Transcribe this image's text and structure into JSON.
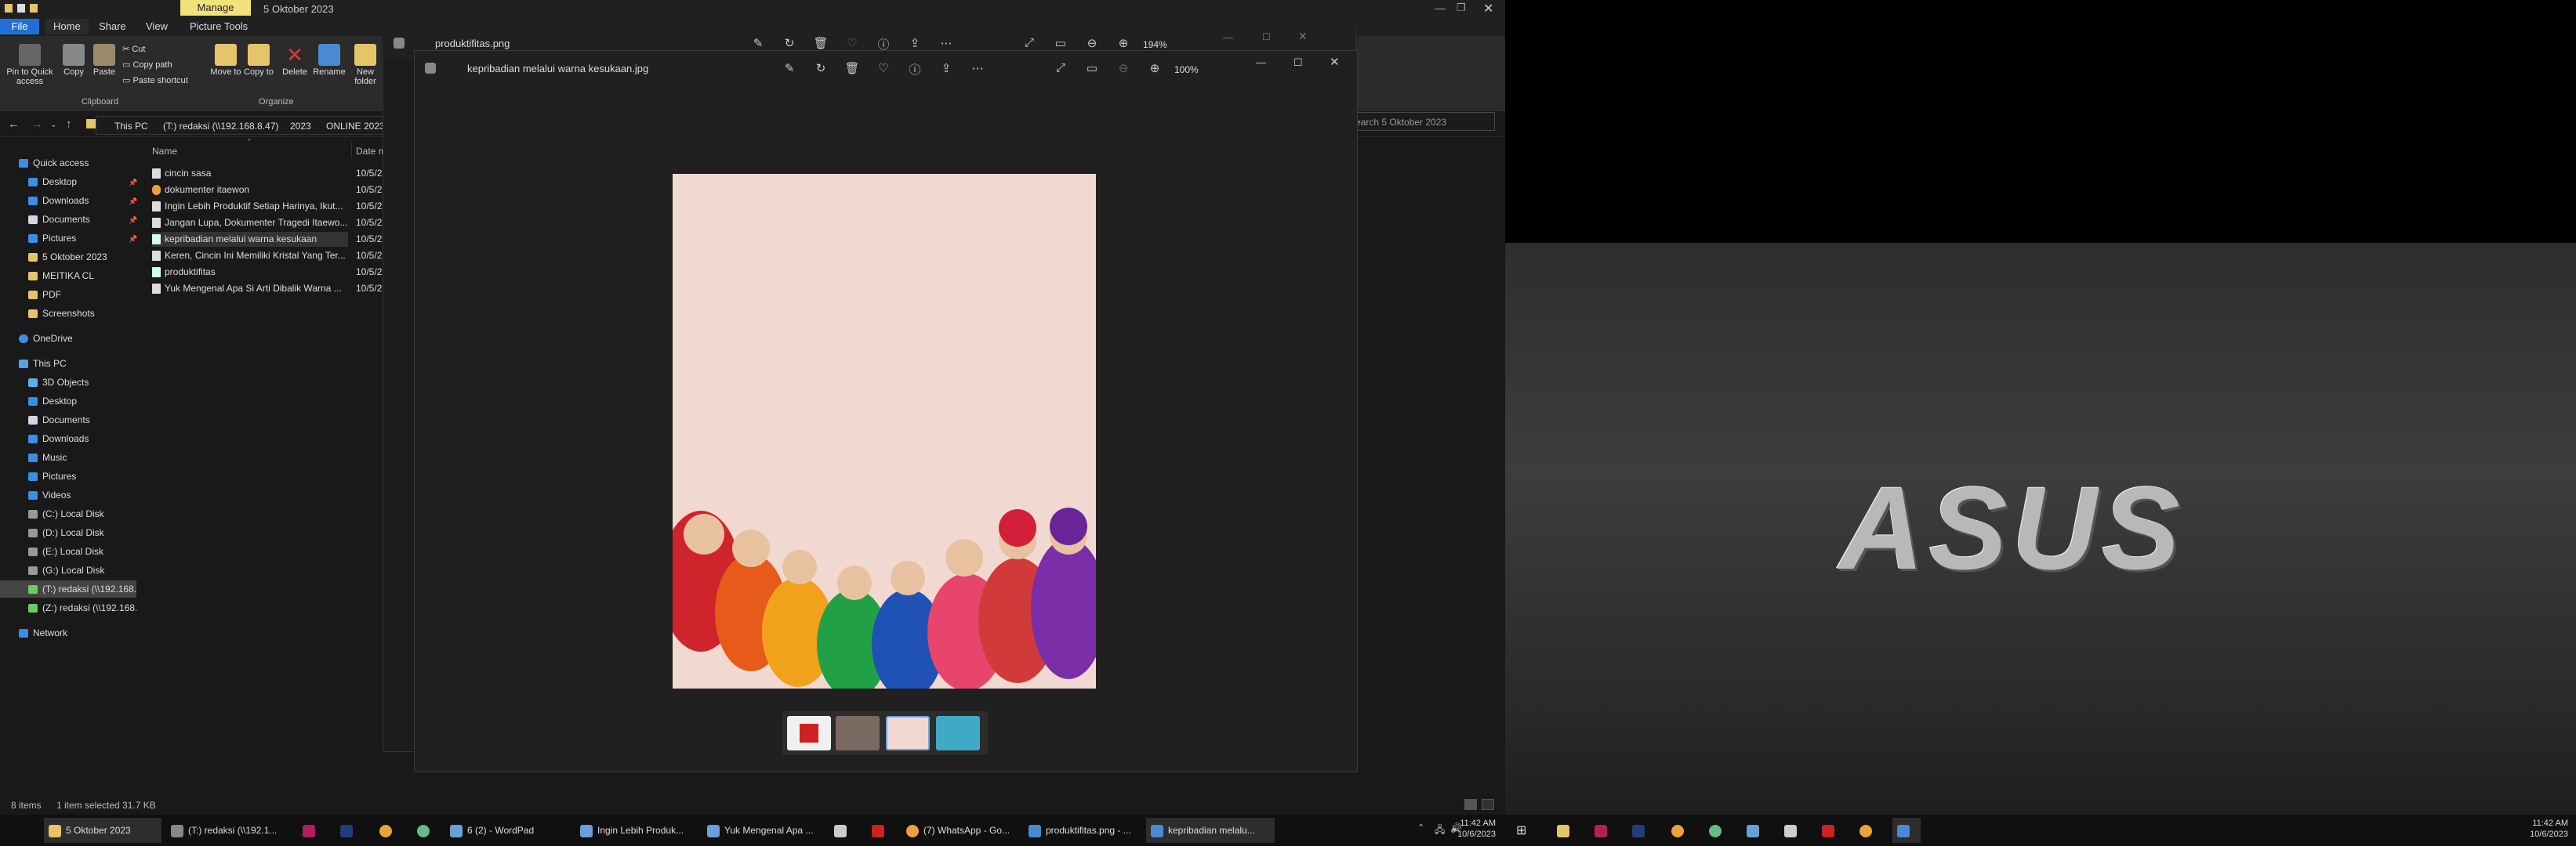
{
  "explorer": {
    "title": "5 Oktober 2023",
    "manage_tab": "Manage",
    "tabs": [
      "File",
      "Home",
      "Share",
      "View",
      "Picture Tools"
    ],
    "ribbon": {
      "pin": "Pin to Quick access",
      "copy": "Copy",
      "paste": "Paste",
      "cut": "Cut",
      "copy_path": "Copy path",
      "paste_shortcut": "Paste shortcut",
      "move_to": "Move to",
      "copy_to": "Copy to",
      "delete": "Delete",
      "rename": "Rename",
      "new_folder": "New folder",
      "group_clipboard": "Clipboard",
      "group_organize": "Organize"
    },
    "breadcrumb": [
      "This PC",
      "(T:) redaksi (\\\\192.168.8.47)",
      "2023",
      "ONLINE 2023"
    ],
    "search_placeholder": "Search 5 Oktober 2023",
    "nav": {
      "quick_access": "Quick access",
      "quick": [
        "Desktop",
        "Downloads",
        "Documents",
        "Pictures",
        "5 Oktober 2023",
        "MEITIKA CL",
        "PDF",
        "Screenshots"
      ],
      "onedrive": "OneDrive",
      "this_pc": "This PC",
      "pc": [
        "3D Objects",
        "Desktop",
        "Documents",
        "Downloads",
        "Music",
        "Pictures",
        "Videos",
        "(C:) Local Disk",
        "(D:) Local Disk",
        "(E:) Local Disk",
        "(G:) Local Disk",
        "(T:) redaksi (\\\\192.168.8",
        "(Z:) redaksi (\\\\192.168.8"
      ],
      "network": "Network"
    },
    "columns": {
      "name": "Name",
      "date": "Date m"
    },
    "files": [
      {
        "name": "cincin sasa",
        "date": "10/5/2"
      },
      {
        "name": "dokumenter itaewon",
        "date": "10/5/2"
      },
      {
        "name": "Ingin Lebih Produktif Setiap Harinya, Ikut...",
        "date": "10/5/2"
      },
      {
        "name": "Jangan Lupa, Dokumenter Tragedi Itaewo...",
        "date": "10/5/2"
      },
      {
        "name": "kepribadian melalui warna kesukaan",
        "date": "10/5/2"
      },
      {
        "name": "Keren, Cincin Ini Memiliki Kristal Yang Ter...",
        "date": "10/5/2"
      },
      {
        "name": "produktifitas",
        "date": "10/5/2"
      },
      {
        "name": "Yuk Mengenal Apa Si Arti Dibalik Warna ...",
        "date": "10/5/2"
      }
    ],
    "status": {
      "items": "8 items",
      "selected": "1 item selected 31.7 KB"
    }
  },
  "viewer_back": {
    "title": "produktifitas.png",
    "zoom": "194%"
  },
  "viewer_front": {
    "title": "kepribadian melalui warna kesukaan.jpg",
    "zoom": "100%"
  },
  "wallpaper": {
    "logo": "ASUS"
  },
  "taskbar": {
    "items": [
      "5 Oktober 2023",
      "(T:) redaksi (\\\\192.1...",
      "6 (2) - WordPad",
      "Ingin Lebih Produk...",
      "Yuk Mengenal Apa ...",
      "(7) WhatsApp - Go...",
      "produktifitas.png - ...",
      "kepribadian melalu..."
    ],
    "time": "11:42 AM",
    "date": "10/6/2023"
  },
  "colors": {
    "accent": "#1f6fd6",
    "manage": "#f2e27a",
    "photo_bg": "#f1d9d2"
  }
}
